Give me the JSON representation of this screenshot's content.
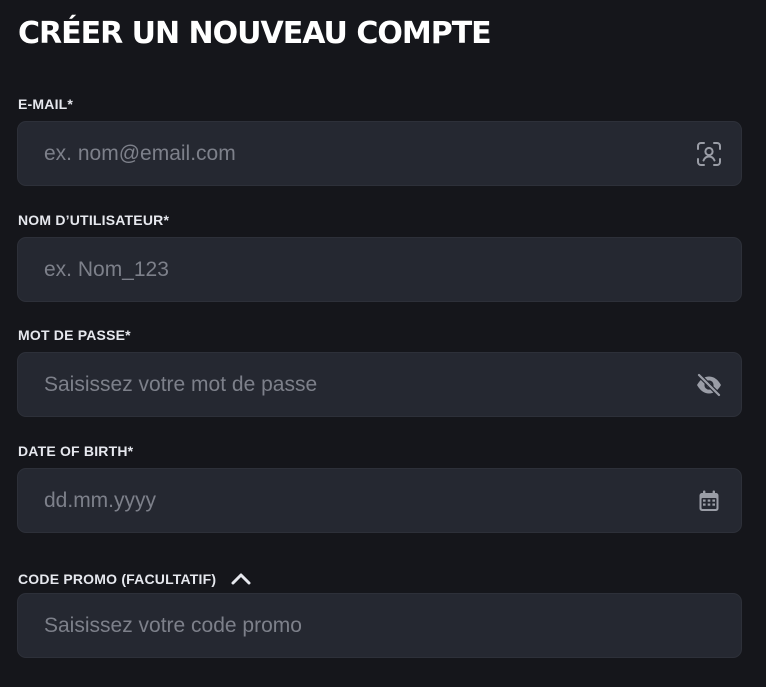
{
  "form": {
    "title": "CRÉER UN NOUVEAU COMPTE",
    "email": {
      "label": "E-MAIL*",
      "placeholder": "ex. nom@email.com",
      "value": "",
      "icon": "account-recognition-icon"
    },
    "username": {
      "label": "NOM D’UTILISATEUR*",
      "placeholder": "ex. Nom_123",
      "value": ""
    },
    "password": {
      "label": "MOT DE PASSE*",
      "placeholder": "Saisissez votre mot de passe",
      "value": "",
      "icon": "eye-off-icon"
    },
    "dob": {
      "label": "DATE OF BIRTH*",
      "placeholder": "dd.mm.yyyy",
      "value": "",
      "icon": "calendar-icon"
    },
    "promo": {
      "label": "CODE PROMO (FACULTATIF)",
      "placeholder": "Saisissez votre code promo",
      "value": "",
      "icon": "chevron-up-icon"
    }
  },
  "colors": {
    "background": "#15161b",
    "field_background": "#252831",
    "label_text": "#e6e8ee",
    "placeholder_text": "#7d808a",
    "icon": "#9a9da6"
  }
}
